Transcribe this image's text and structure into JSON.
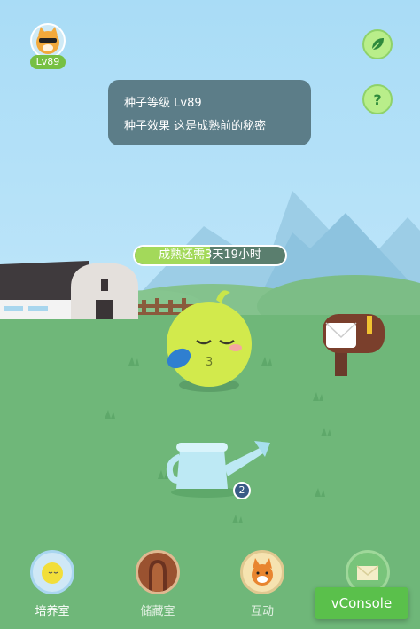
{
  "user": {
    "level_badge": "Lv89"
  },
  "seed_info": {
    "level_line": "种子等级 Lv89",
    "effect_line": "种子效果 这是成熟前的秘密"
  },
  "growth": {
    "status_text": "成熟还需3天19小时",
    "progress_percent": 50
  },
  "watering_can": {
    "count": "2"
  },
  "bottom_nav": {
    "items": [
      {
        "label": "培养室",
        "icon": "seed-icon",
        "selected": true
      },
      {
        "label": "储藏室",
        "icon": "door-icon",
        "selected": false
      },
      {
        "label": "互动",
        "icon": "fox-icon",
        "selected": false
      },
      {
        "label": "",
        "icon": "envelope-icon",
        "selected": false
      }
    ]
  },
  "debug": {
    "vconsole_label": "vConsole"
  },
  "colors": {
    "sky": "#a9dcf6",
    "ground": "#6fb779",
    "accent_green": "#76c043",
    "tooltip_bg": "#5c7d88",
    "vconsole_green": "#5ac04b"
  }
}
